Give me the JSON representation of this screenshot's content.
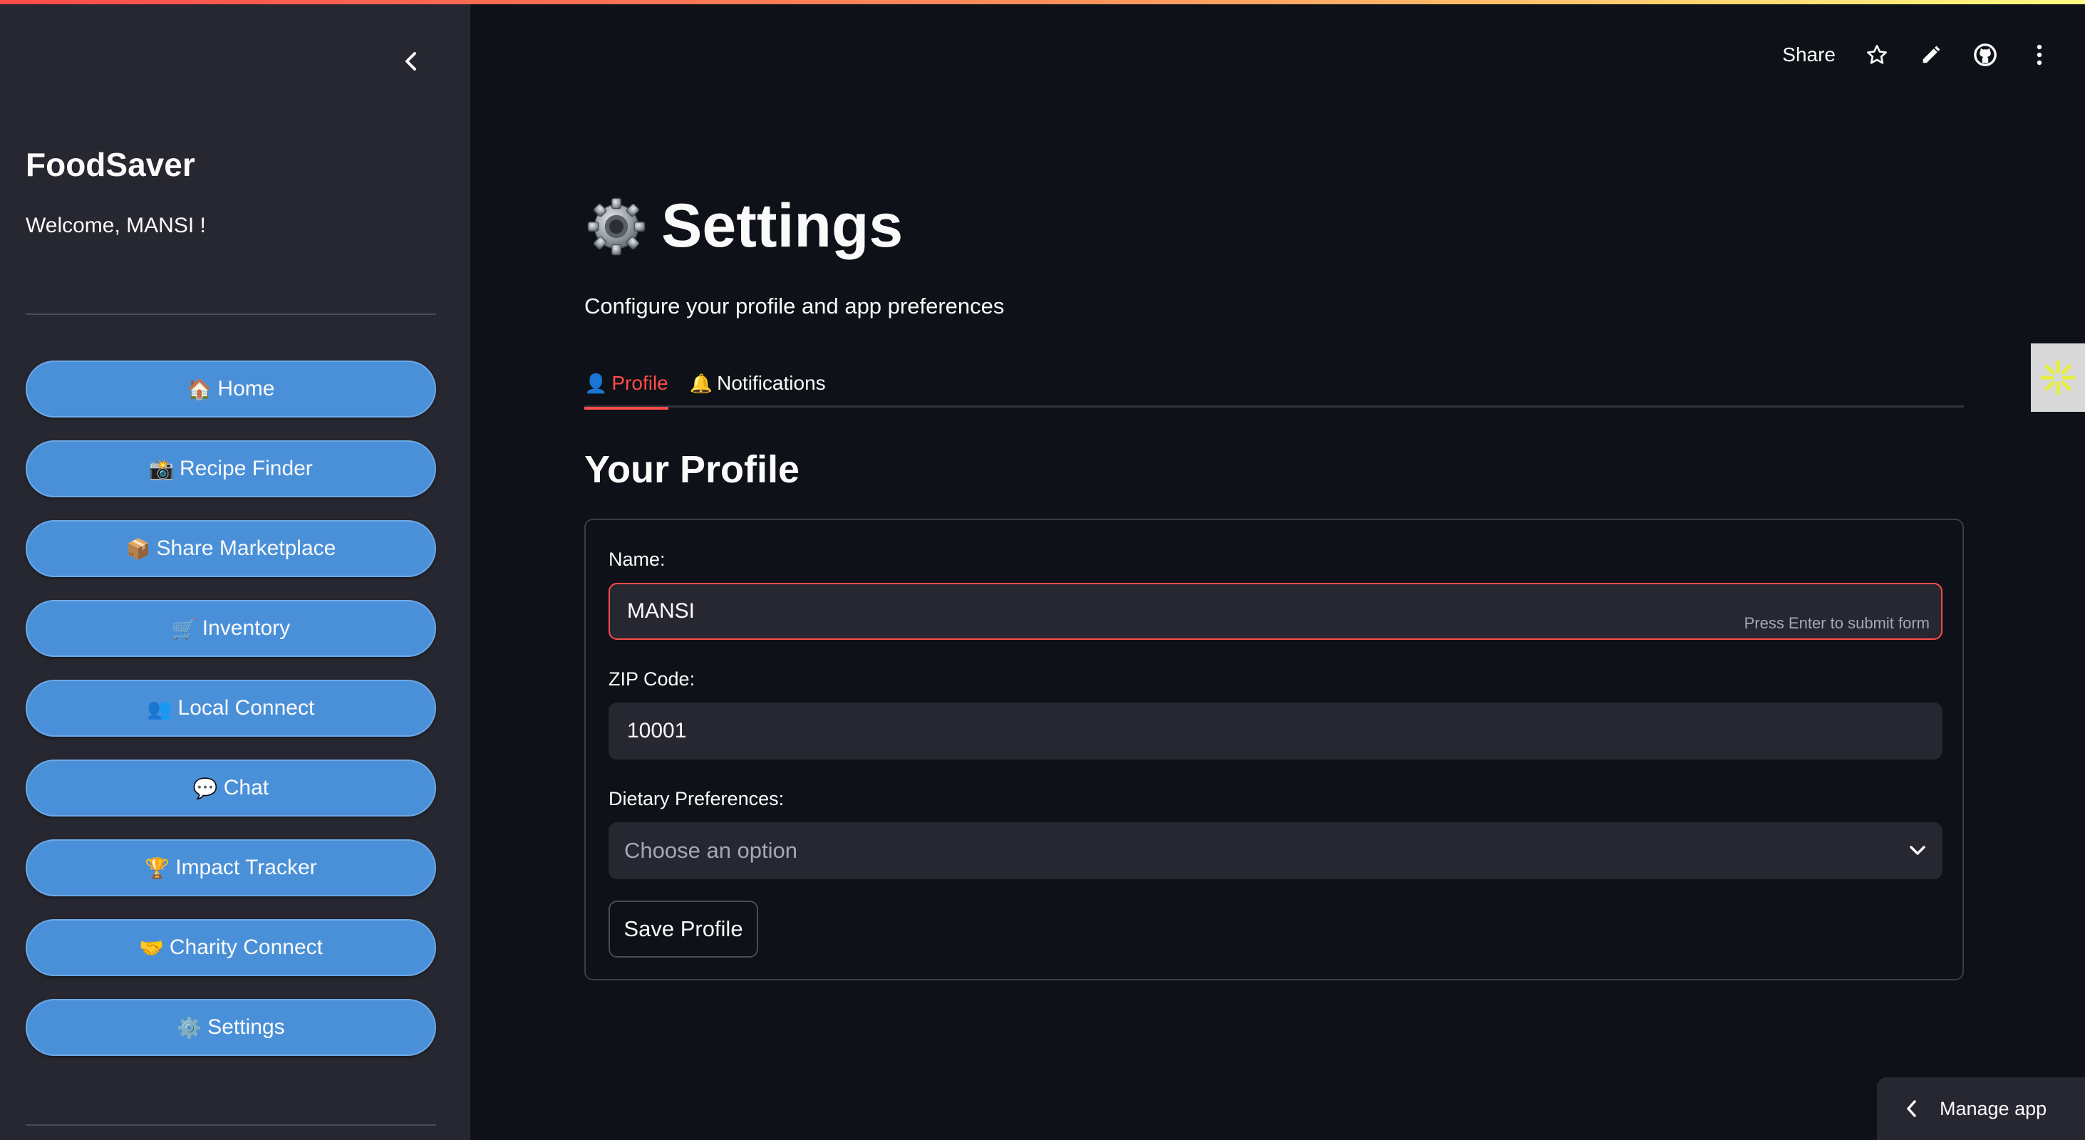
{
  "sidebar": {
    "brand": "FoodSaver",
    "welcome": "Welcome, MANSI !",
    "nav": [
      {
        "icon": "🏠",
        "label": "Home"
      },
      {
        "icon": "📸",
        "label": "Recipe Finder"
      },
      {
        "icon": "📦",
        "label": "Share Marketplace"
      },
      {
        "icon": "🛒",
        "label": "Inventory"
      },
      {
        "icon": "👥",
        "label": "Local Connect"
      },
      {
        "icon": "💬",
        "label": "Chat"
      },
      {
        "icon": "🏆",
        "label": "Impact Tracker"
      },
      {
        "icon": "🤝",
        "label": "Charity Connect"
      },
      {
        "icon": "⚙️",
        "label": "Settings"
      }
    ]
  },
  "toolbar": {
    "share_label": "Share",
    "icons": [
      "star-icon",
      "pencil-icon",
      "github-icon",
      "more-vertical-icon"
    ]
  },
  "page": {
    "title": "Settings",
    "subtitle": "Configure your profile and app preferences",
    "tabs": [
      {
        "icon": "👤",
        "label": "Profile",
        "active": true
      },
      {
        "icon": "🔔",
        "label": "Notifications",
        "active": false
      }
    ],
    "section_title": "Your Profile"
  },
  "form": {
    "name_label": "Name:",
    "name_value": "MANSI",
    "enter_hint": "Press Enter to submit form",
    "zip_label": "ZIP Code:",
    "zip_value": "10001",
    "diet_label": "Dietary Preferences:",
    "diet_placeholder": "Choose an option",
    "save_label": "Save Profile"
  },
  "footer": {
    "manage_app_label": "Manage app"
  },
  "colors": {
    "background": "#0e1117",
    "sidebar": "#262730",
    "nav_button": "#4a90d9",
    "accent": "#ff4b4b"
  }
}
